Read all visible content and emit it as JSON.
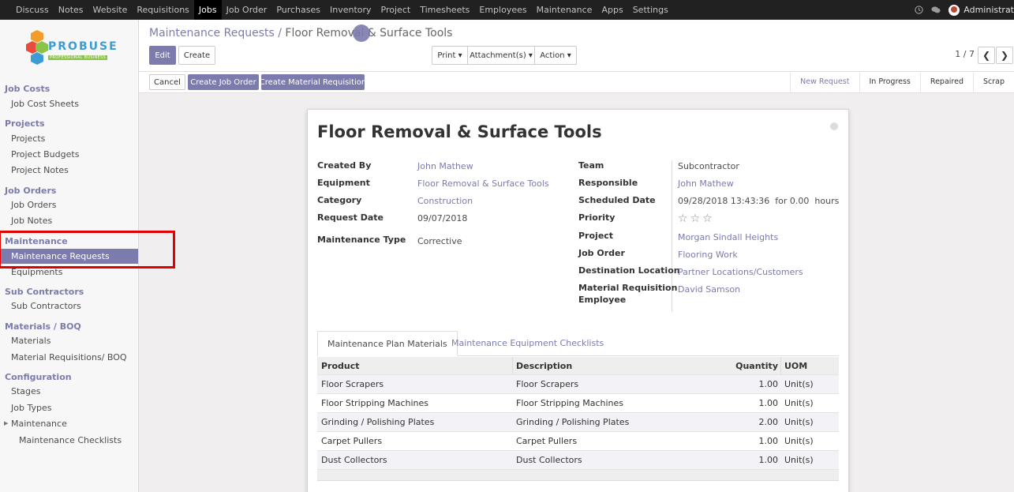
{
  "topnav": [
    "Discuss",
    "Notes",
    "Website",
    "Requisitions",
    "Jobs",
    "Job Order",
    "Purchases",
    "Inventory",
    "Project",
    "Timesheets",
    "Employees",
    "Maintenance",
    "Apps",
    "Settings"
  ],
  "topnav_active": "Jobs",
  "user": "Administrat",
  "logo": {
    "word": "PROBUSE",
    "tagline": "PROFESSIONAL BUSINESS"
  },
  "sidebar": {
    "job_costs": {
      "title": "Job Costs",
      "items": [
        "Job Cost Sheets"
      ]
    },
    "projects": {
      "title": "Projects",
      "items": [
        "Projects",
        "Project Budgets",
        "Project Notes"
      ]
    },
    "job_orders": {
      "title": "Job Orders",
      "items": [
        "Job Orders",
        "Job Notes"
      ]
    },
    "maintenance": {
      "title": "Maintenance",
      "items": [
        "Maintenance Requests",
        "Equipments"
      ]
    },
    "sub_contractors": {
      "title": "Sub Contractors",
      "items": [
        "Sub Contractors"
      ]
    },
    "materials": {
      "title": "Materials / BOQ",
      "items": [
        "Materials",
        "Material Requisitions/ BOQ"
      ]
    },
    "configuration": {
      "title": "Configuration",
      "items": [
        "Stages",
        "Job Types",
        "Maintenance",
        "Maintenance Checklists"
      ]
    }
  },
  "breadcrumb": {
    "parent": "Maintenance Requests /",
    "current": "Floor Removal & Surface Tools"
  },
  "buttons": {
    "edit": "Edit",
    "create": "Create",
    "print": "Print ▾",
    "attachments": "Attachment(s) ▾",
    "action": "Action ▾"
  },
  "pager": {
    "text": "1 / 7"
  },
  "statusbar": {
    "cancel": "Cancel",
    "create_job_order": "Create Job Order",
    "create_material_requisition": "Create Material Requisition"
  },
  "stages": [
    "New Request",
    "In Progress",
    "Repaired",
    "Scrap"
  ],
  "active_stage": "New Request",
  "record": {
    "title": "Floor Removal & Surface Tools",
    "left": [
      {
        "label": "Created By",
        "value": "John Mathew"
      },
      {
        "label": "Equipment",
        "value": "Floor Removal & Surface Tools"
      },
      {
        "label": "Category",
        "value": "Construction"
      },
      {
        "label": "Request Date",
        "value": "09/07/2018"
      },
      {
        "label": "Maintenance Type",
        "value": "Corrective"
      }
    ],
    "right": [
      {
        "label": "Team",
        "value": "Subcontractor"
      },
      {
        "label": "Responsible",
        "value": "John Mathew"
      },
      {
        "label": "Scheduled Date",
        "value": "09/28/2018 13:43:36  for 0.00  hours"
      },
      {
        "label": "Priority",
        "value": ""
      },
      {
        "label": "Project",
        "value": "Morgan Sindall Heights"
      },
      {
        "label": "Job Order",
        "value": "Flooring Work"
      },
      {
        "label": "Destination Location",
        "value": "Partner Locations/Customers"
      },
      {
        "label": "Material Requisition",
        "label2": "Employee",
        "value": "David Samson"
      }
    ],
    "priority_stars": 0
  },
  "tabs": [
    "Maintenance Plan Materials",
    "Maintenance Equipment Checklists"
  ],
  "table": {
    "headers": [
      "Product",
      "Description",
      "Quantity",
      "UOM"
    ],
    "rows": [
      [
        "Floor Scrapers",
        "Floor Scrapers",
        "1.00",
        "Unit(s)"
      ],
      [
        "Floor Stripping Machines",
        "Floor Stripping Machines",
        "1.00",
        "Unit(s)"
      ],
      [
        "Grinding / Polishing Plates",
        "Grinding / Polishing Plates",
        "2.00",
        "Unit(s)"
      ],
      [
        "Carpet Pullers",
        "Carpet Pullers",
        "1.00",
        "Unit(s)"
      ],
      [
        "Dust Collectors",
        "Dust Collectors",
        "1.00",
        "Unit(s)"
      ]
    ]
  },
  "colors": {
    "brand": "#7c7bad",
    "topbar": "#212121",
    "highlight": "#e00000"
  }
}
